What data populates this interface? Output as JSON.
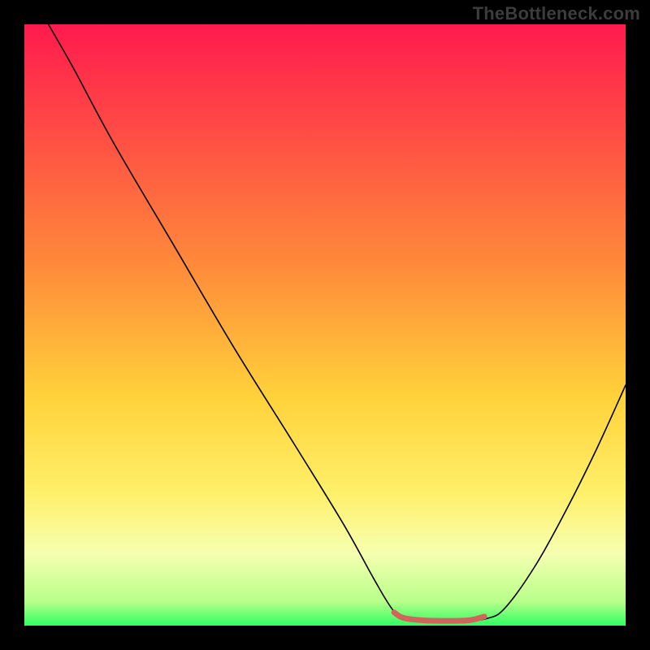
{
  "watermark": "TheBottleneck.com",
  "chart_data": {
    "type": "line",
    "title": "",
    "xlabel": "",
    "ylabel": "",
    "xlim": [
      0,
      100
    ],
    "ylim": [
      0,
      100
    ],
    "background_gradient": {
      "stops": [
        {
          "offset": 0,
          "color": "#ff1a4e"
        },
        {
          "offset": 40,
          "color": "#ff8a3a"
        },
        {
          "offset": 62,
          "color": "#ffd23a"
        },
        {
          "offset": 78,
          "color": "#fff06a"
        },
        {
          "offset": 88,
          "color": "#f6ffb0"
        },
        {
          "offset": 96,
          "color": "#b8ff8a"
        },
        {
          "offset": 100,
          "color": "#2fff62"
        }
      ]
    },
    "series": [
      {
        "name": "bottleneck-curve",
        "color": "#000000",
        "width": 1.6,
        "points": [
          {
            "x": 4,
            "y": 100
          },
          {
            "x": 8,
            "y": 93
          },
          {
            "x": 15,
            "y": 80
          },
          {
            "x": 25,
            "y": 63
          },
          {
            "x": 35,
            "y": 46
          },
          {
            "x": 45,
            "y": 30
          },
          {
            "x": 53,
            "y": 17
          },
          {
            "x": 58,
            "y": 8
          },
          {
            "x": 61,
            "y": 3
          },
          {
            "x": 63,
            "y": 1.2
          },
          {
            "x": 68,
            "y": 0.8
          },
          {
            "x": 73,
            "y": 0.8
          },
          {
            "x": 77,
            "y": 1.2
          },
          {
            "x": 80,
            "y": 3
          },
          {
            "x": 85,
            "y": 10
          },
          {
            "x": 90,
            "y": 19
          },
          {
            "x": 95,
            "y": 29
          },
          {
            "x": 100,
            "y": 40
          }
        ]
      },
      {
        "name": "optimal-zone",
        "color": "#d1655c",
        "width": 7,
        "cap": "round",
        "points": [
          {
            "x": 61.5,
            "y": 2.2
          },
          {
            "x": 63,
            "y": 1.3
          },
          {
            "x": 66,
            "y": 0.9
          },
          {
            "x": 70,
            "y": 0.8
          },
          {
            "x": 74,
            "y": 0.9
          },
          {
            "x": 76.5,
            "y": 1.5
          }
        ]
      }
    ]
  }
}
